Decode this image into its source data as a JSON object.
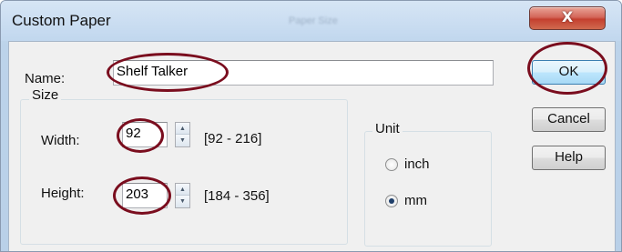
{
  "dialog": {
    "title": "Custom Paper",
    "ghost_title": "Paper Size",
    "close_symbol": "X"
  },
  "name": {
    "label": "Name:",
    "value": "Shelf Talker"
  },
  "size": {
    "group_label": "Size",
    "width": {
      "label": "Width:",
      "value": "92",
      "range": "[92 - 216]"
    },
    "height": {
      "label": "Height:",
      "value": "203",
      "range": "[184 - 356]"
    }
  },
  "unit": {
    "group_label": "Unit",
    "options": [
      {
        "label": "inch",
        "checked": false
      },
      {
        "label": "mm",
        "checked": true
      }
    ]
  },
  "buttons": {
    "ok": "OK",
    "cancel": "Cancel",
    "help": "Help"
  },
  "annotation_color": "#7a0d1e"
}
